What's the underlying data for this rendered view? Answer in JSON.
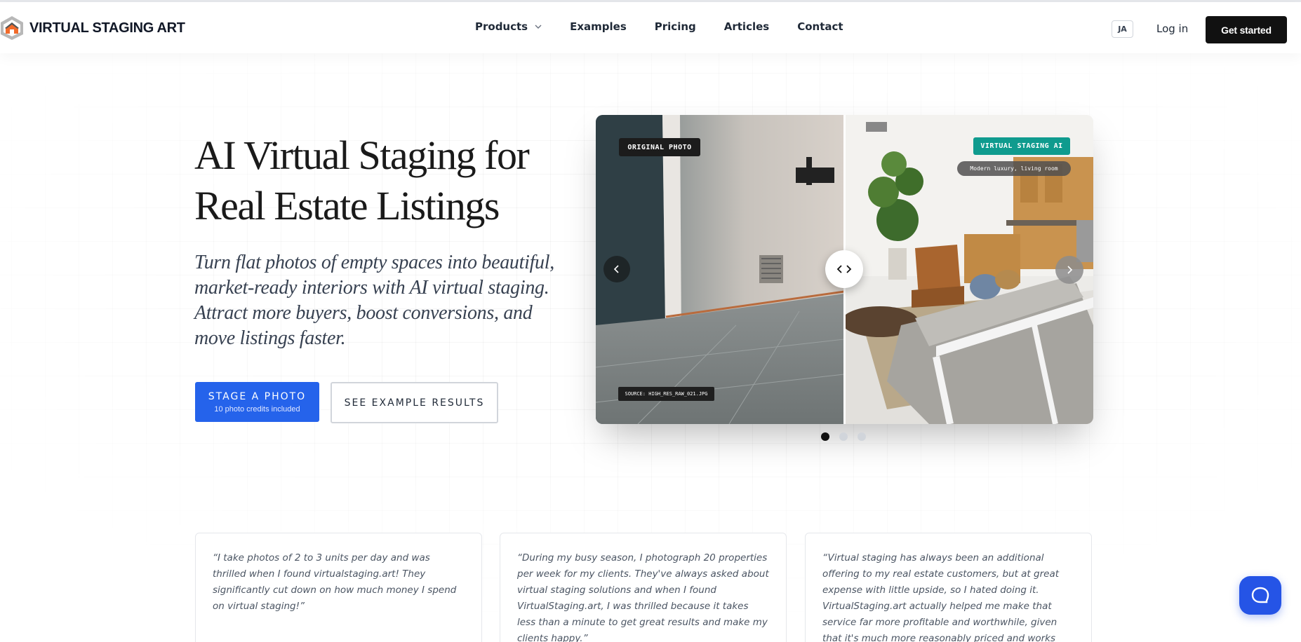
{
  "brand": {
    "name": "VIRTUAL STAGING ART"
  },
  "nav": {
    "items": [
      {
        "label": "Products",
        "has_dropdown": true
      },
      {
        "label": "Examples"
      },
      {
        "label": "Pricing"
      },
      {
        "label": "Articles"
      },
      {
        "label": "Contact"
      }
    ],
    "language": "JA",
    "login": "Log in",
    "cta": "Get started"
  },
  "hero": {
    "title": "AI Virtual Staging for Real Estate Listings",
    "subtitle": "Turn flat photos of empty spaces into beautiful, market-ready interiors with AI virtual staging. Attract more buyers, boost conversions, and move listings faster.",
    "primary_button": {
      "label": "STAGE A PHOTO",
      "sublabel": "10 photo credits included"
    },
    "secondary_button": {
      "label": "SEE EXAMPLE RESULTS"
    }
  },
  "slider": {
    "original_tag": "ORIGINAL PHOTO",
    "source_tag": "SOURCE: HIGH_RES_RAW_021.JPG",
    "staged_tag": "VIRTUAL STAGING AI",
    "style_tag": "Modern luxury, living room",
    "slide_count": 3,
    "active_slide": 1
  },
  "testimonials": [
    {
      "quote": "“I take photos of 2 to 3 units per day and was thrilled when I found virtualstaging.art! They significantly cut down on how much money I spend on virtual staging!”"
    },
    {
      "quote": "“During my busy season, I photograph 20 properties per week for my clients. They've always asked about virtual staging solutions and when I found VirtualStaging.art, I was thrilled because it takes less than a minute to get great results and make my clients happy.”"
    },
    {
      "quote": "“Virtual staging has always been an additional offering to my real estate customers, but at great expense with little upside, so I hated doing it. VirtualStaging.art actually helped me make that service far more profitable and worthwhile, given that it's much more reasonably priced and works great for the properties that I photograph. It's"
    }
  ],
  "colors": {
    "primary": "#2563eb",
    "teal_tag": "#0f9b8e",
    "dark": "#111111"
  }
}
